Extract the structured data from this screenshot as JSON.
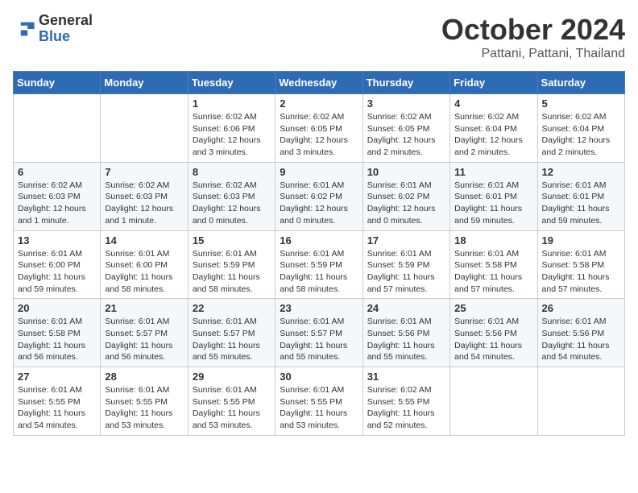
{
  "logo": {
    "general": "General",
    "blue": "Blue"
  },
  "header": {
    "month": "October 2024",
    "location": "Pattani, Pattani, Thailand"
  },
  "weekdays": [
    "Sunday",
    "Monday",
    "Tuesday",
    "Wednesday",
    "Thursday",
    "Friday",
    "Saturday"
  ],
  "weeks": [
    [
      {
        "day": "",
        "info": ""
      },
      {
        "day": "",
        "info": ""
      },
      {
        "day": "1",
        "info": "Sunrise: 6:02 AM\nSunset: 6:06 PM\nDaylight: 12 hours\nand 3 minutes."
      },
      {
        "day": "2",
        "info": "Sunrise: 6:02 AM\nSunset: 6:05 PM\nDaylight: 12 hours\nand 3 minutes."
      },
      {
        "day": "3",
        "info": "Sunrise: 6:02 AM\nSunset: 6:05 PM\nDaylight: 12 hours\nand 2 minutes."
      },
      {
        "day": "4",
        "info": "Sunrise: 6:02 AM\nSunset: 6:04 PM\nDaylight: 12 hours\nand 2 minutes."
      },
      {
        "day": "5",
        "info": "Sunrise: 6:02 AM\nSunset: 6:04 PM\nDaylight: 12 hours\nand 2 minutes."
      }
    ],
    [
      {
        "day": "6",
        "info": "Sunrise: 6:02 AM\nSunset: 6:03 PM\nDaylight: 12 hours\nand 1 minute."
      },
      {
        "day": "7",
        "info": "Sunrise: 6:02 AM\nSunset: 6:03 PM\nDaylight: 12 hours\nand 1 minute."
      },
      {
        "day": "8",
        "info": "Sunrise: 6:02 AM\nSunset: 6:03 PM\nDaylight: 12 hours\nand 0 minutes."
      },
      {
        "day": "9",
        "info": "Sunrise: 6:01 AM\nSunset: 6:02 PM\nDaylight: 12 hours\nand 0 minutes."
      },
      {
        "day": "10",
        "info": "Sunrise: 6:01 AM\nSunset: 6:02 PM\nDaylight: 12 hours\nand 0 minutes."
      },
      {
        "day": "11",
        "info": "Sunrise: 6:01 AM\nSunset: 6:01 PM\nDaylight: 11 hours\nand 59 minutes."
      },
      {
        "day": "12",
        "info": "Sunrise: 6:01 AM\nSunset: 6:01 PM\nDaylight: 11 hours\nand 59 minutes."
      }
    ],
    [
      {
        "day": "13",
        "info": "Sunrise: 6:01 AM\nSunset: 6:00 PM\nDaylight: 11 hours\nand 59 minutes."
      },
      {
        "day": "14",
        "info": "Sunrise: 6:01 AM\nSunset: 6:00 PM\nDaylight: 11 hours\nand 58 minutes."
      },
      {
        "day": "15",
        "info": "Sunrise: 6:01 AM\nSunset: 5:59 PM\nDaylight: 11 hours\nand 58 minutes."
      },
      {
        "day": "16",
        "info": "Sunrise: 6:01 AM\nSunset: 5:59 PM\nDaylight: 11 hours\nand 58 minutes."
      },
      {
        "day": "17",
        "info": "Sunrise: 6:01 AM\nSunset: 5:59 PM\nDaylight: 11 hours\nand 57 minutes."
      },
      {
        "day": "18",
        "info": "Sunrise: 6:01 AM\nSunset: 5:58 PM\nDaylight: 11 hours\nand 57 minutes."
      },
      {
        "day": "19",
        "info": "Sunrise: 6:01 AM\nSunset: 5:58 PM\nDaylight: 11 hours\nand 57 minutes."
      }
    ],
    [
      {
        "day": "20",
        "info": "Sunrise: 6:01 AM\nSunset: 5:58 PM\nDaylight: 11 hours\nand 56 minutes."
      },
      {
        "day": "21",
        "info": "Sunrise: 6:01 AM\nSunset: 5:57 PM\nDaylight: 11 hours\nand 56 minutes."
      },
      {
        "day": "22",
        "info": "Sunrise: 6:01 AM\nSunset: 5:57 PM\nDaylight: 11 hours\nand 55 minutes."
      },
      {
        "day": "23",
        "info": "Sunrise: 6:01 AM\nSunset: 5:57 PM\nDaylight: 11 hours\nand 55 minutes."
      },
      {
        "day": "24",
        "info": "Sunrise: 6:01 AM\nSunset: 5:56 PM\nDaylight: 11 hours\nand 55 minutes."
      },
      {
        "day": "25",
        "info": "Sunrise: 6:01 AM\nSunset: 5:56 PM\nDaylight: 11 hours\nand 54 minutes."
      },
      {
        "day": "26",
        "info": "Sunrise: 6:01 AM\nSunset: 5:56 PM\nDaylight: 11 hours\nand 54 minutes."
      }
    ],
    [
      {
        "day": "27",
        "info": "Sunrise: 6:01 AM\nSunset: 5:55 PM\nDaylight: 11 hours\nand 54 minutes."
      },
      {
        "day": "28",
        "info": "Sunrise: 6:01 AM\nSunset: 5:55 PM\nDaylight: 11 hours\nand 53 minutes."
      },
      {
        "day": "29",
        "info": "Sunrise: 6:01 AM\nSunset: 5:55 PM\nDaylight: 11 hours\nand 53 minutes."
      },
      {
        "day": "30",
        "info": "Sunrise: 6:01 AM\nSunset: 5:55 PM\nDaylight: 11 hours\nand 53 minutes."
      },
      {
        "day": "31",
        "info": "Sunrise: 6:02 AM\nSunset: 5:55 PM\nDaylight: 11 hours\nand 52 minutes."
      },
      {
        "day": "",
        "info": ""
      },
      {
        "day": "",
        "info": ""
      }
    ]
  ]
}
